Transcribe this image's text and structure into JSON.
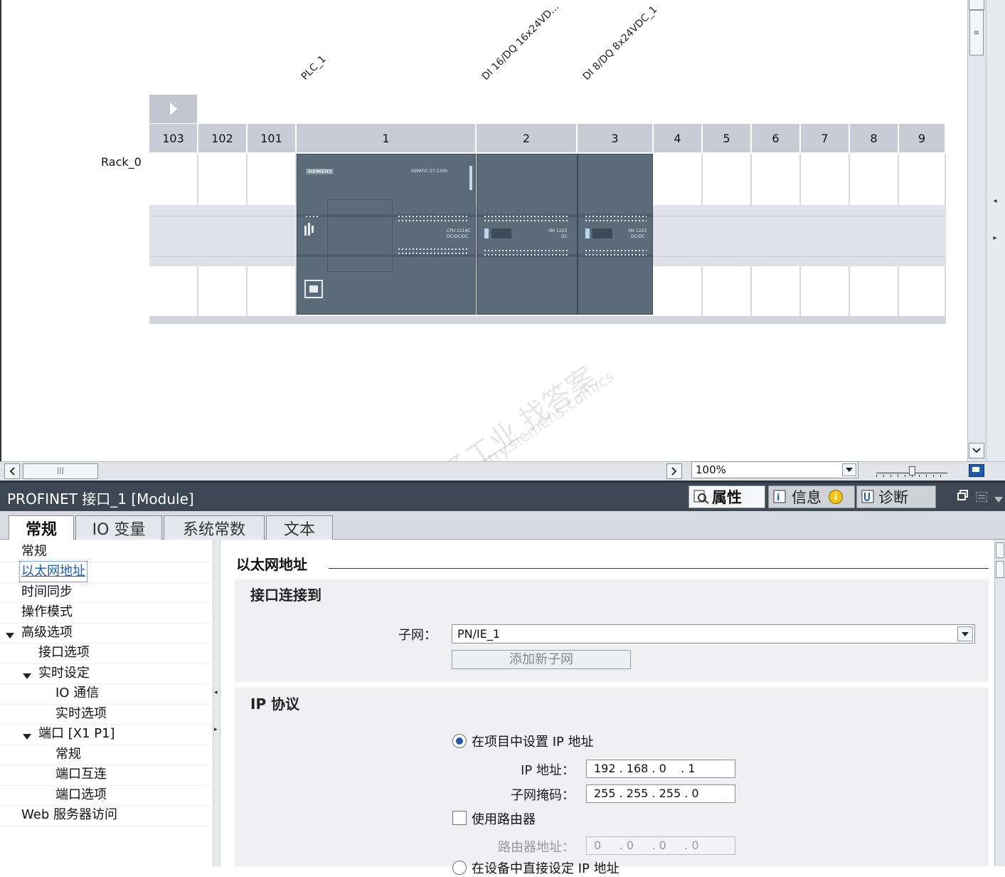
{
  "device_view": {
    "module_labels": [
      "PLC_1",
      "DI 16/DQ 16x24VD...",
      "DI 8/DQ 8x24VDC_1"
    ],
    "rack_label": "Rack_0",
    "slots": [
      "103",
      "102",
      "101",
      "1",
      "2",
      "3",
      "4",
      "5",
      "6",
      "7",
      "8",
      "9"
    ],
    "cpu_text": {
      "brand": "SIEMENS",
      "model": "SIMATIC S7-1200",
      "cpu": "CPU 1214C",
      "type": "DC/DC/DC"
    },
    "sm1_text": {
      "model": "SM 1223",
      "type": "DC"
    },
    "sm2_text": {
      "model": "SM 1223",
      "type": "DC/DC"
    }
  },
  "zoom": {
    "value": "100%"
  },
  "watermark": {
    "line1": "西门子工业   找答案",
    "line2": "support.industry.siemens.com/cs"
  },
  "inspector": {
    "title": "PROFINET 接口_1 [Module]",
    "tabs": [
      {
        "label": "属性",
        "icon": "properties-icon"
      },
      {
        "label": "信息",
        "icon": "info-icon"
      },
      {
        "label": "诊断",
        "icon": "diagnostics-icon"
      }
    ],
    "property_tabs": [
      "常规",
      "IO 变量",
      "系统常数",
      "文本"
    ]
  },
  "nav": [
    {
      "label": "常规",
      "indent": 0
    },
    {
      "label": "以太网地址",
      "indent": 0,
      "selected": true
    },
    {
      "label": "时间同步",
      "indent": 0
    },
    {
      "label": "操作模式",
      "indent": 0
    },
    {
      "label": "高级选项",
      "indent": 0,
      "expand": true
    },
    {
      "label": "接口选项",
      "indent": 1
    },
    {
      "label": "实时设定",
      "indent": 1,
      "expand": true
    },
    {
      "label": "IO 通信",
      "indent": 2
    },
    {
      "label": "实时选项",
      "indent": 2
    },
    {
      "label": "端口 [X1 P1]",
      "indent": 1,
      "expand": true
    },
    {
      "label": "常规",
      "indent": 2
    },
    {
      "label": "端口互连",
      "indent": 2
    },
    {
      "label": "端口选项",
      "indent": 2
    },
    {
      "label": "Web 服务器访问",
      "indent": 0
    }
  ],
  "content": {
    "section_title": "以太网地址",
    "interface_group": {
      "title": "接口连接到",
      "subnet_label": "子网：",
      "subnet_value": "PN/IE_1",
      "add_subnet_button": "添加新子网"
    },
    "ip_group": {
      "title": "IP 协议",
      "radio_set_in_project": "在项目中设置 IP 地址",
      "ip_label": "IP 地址：",
      "ip_value": "192 . 168 . 0    . 1",
      "mask_label": "子网掩码：",
      "mask_value": "255 . 255 . 255 . 0",
      "use_router": "使用路由器",
      "router_label": "路由器地址：",
      "router_value": "0     . 0     . 0     . 0",
      "radio_set_on_device": "在设备中直接设定 IP 地址"
    }
  }
}
